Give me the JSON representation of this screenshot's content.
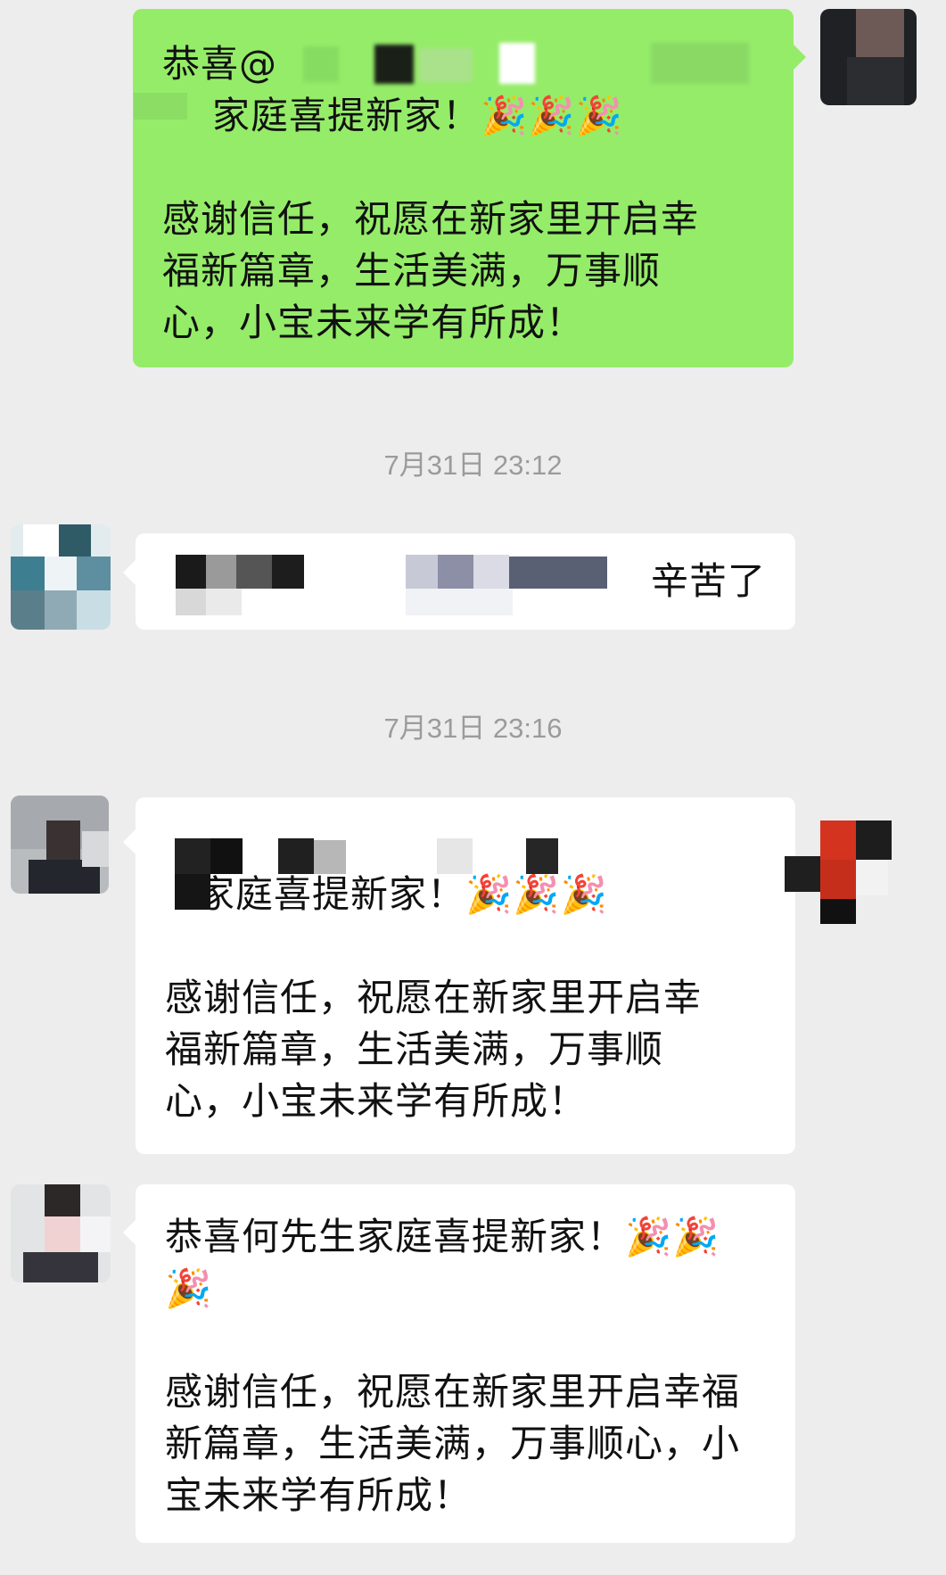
{
  "messages": [
    {
      "id": "m1",
      "side": "right",
      "lines": [
        "恭喜@",
        "家庭喜提新家！🎉🎉🎉",
        "",
        "感谢信任，祝愿在新家里开启幸",
        "福新篇章，生活美满，万事顺",
        "心，小宝未来学有所成！"
      ]
    },
    {
      "id": "m2",
      "side": "left",
      "text": "辛苦了"
    },
    {
      "id": "m3",
      "side": "left",
      "lines": [
        "家庭喜提新家！🎉🎉🎉",
        "",
        "感谢信任，祝愿在新家里开启幸",
        "福新篇章，生活美满，万事顺",
        "心，小宝未来学有所成！"
      ]
    },
    {
      "id": "m4",
      "side": "left",
      "lines": [
        "恭喜何先生家庭喜提新家！🎉🎉",
        "🎉",
        "",
        "感谢信任，祝愿在新家里开启幸福",
        "新篇章，生活美满，万事顺心，小",
        "宝未来学有所成！"
      ]
    }
  ],
  "timestamps": [
    "7月31日 23:12",
    "7月31日 23:16"
  ],
  "colors": {
    "background": "#ededed",
    "my_bubble": "#95ec69",
    "other_bubble": "#ffffff",
    "timestamp": "#9b9b9b"
  }
}
